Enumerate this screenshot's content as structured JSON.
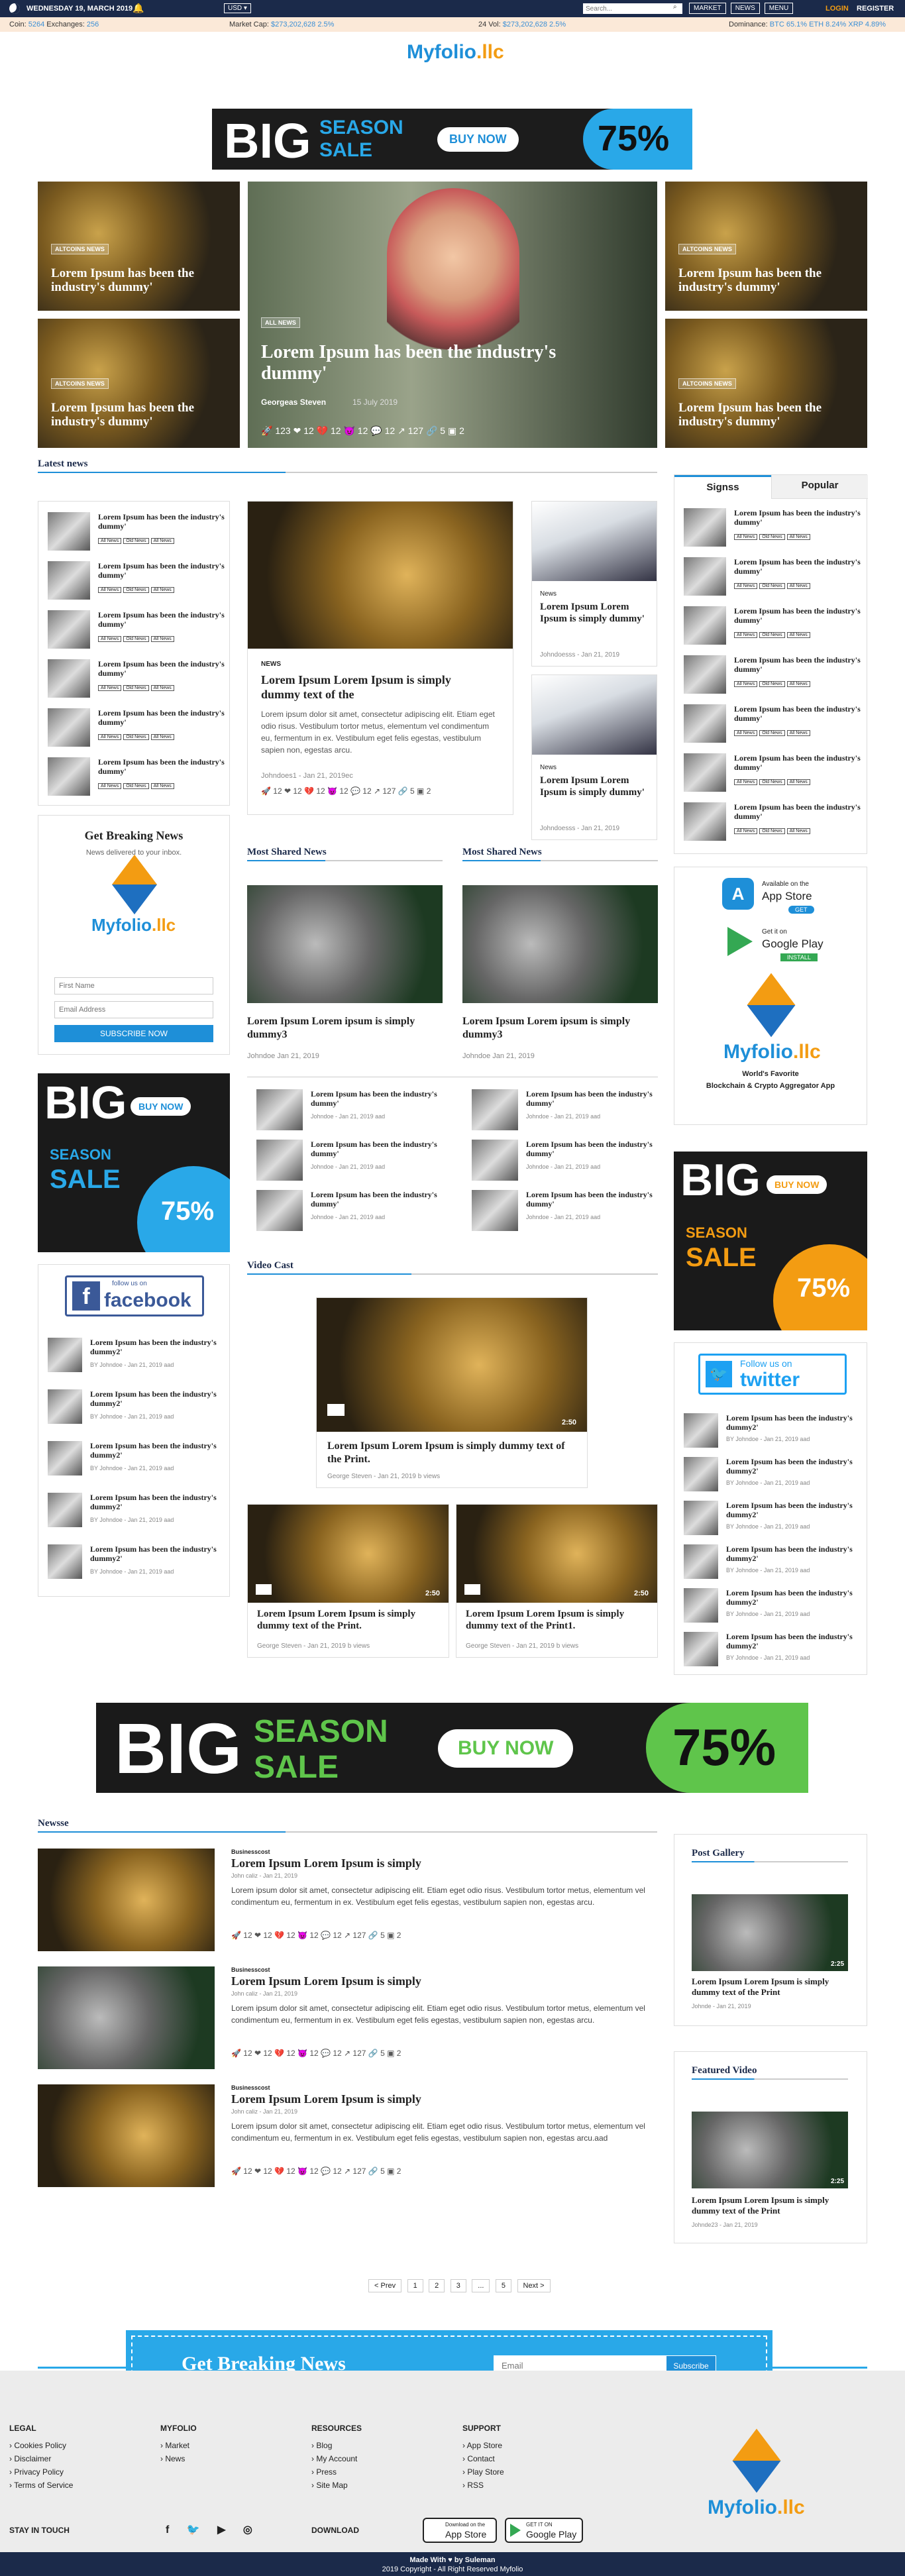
{
  "topbar": {
    "date": "WEDNESDAY 19, MARCH 2019",
    "currency": "USD",
    "search_placeholder": "Search...",
    "market": "MARKET",
    "news": "NEWS",
    "menu": "MENU",
    "login": "LOGIN",
    "register": "REGISTER"
  },
  "ticker": {
    "coins_label": "Coin:",
    "coins": "5264",
    "exchanges_label": "Exchanges:",
    "exchanges": "256",
    "mcap_label": "Market Cap:",
    "mcap": "$273,202,628 2.5%",
    "vol_label": "24 Vol:",
    "vol": "$273,202,628 2.5%",
    "dom_label": "Dominance:",
    "dom": "BTC 65.1% ETH 8.24% XRP 4.89%"
  },
  "logo": {
    "main": "Myfolio",
    "suffix": ".llc"
  },
  "banner1": {
    "big": "BIG",
    "season": "SEASON",
    "sale": "SALE",
    "buy": "BUY NOW",
    "pct": "75%"
  },
  "hero": {
    "side_tag": "ALTCOINS NEWS",
    "side_title": "Lorem Ipsum has been the industry's dummy'",
    "main_tag": "ALL NEWS",
    "main_title": "Lorem Ipsum has been the industry's dummy'",
    "author": "Georgeas Steven",
    "date": "15 July 2019",
    "stats": [
      "123",
      "12",
      "12",
      "12",
      "12",
      "127",
      "5",
      "2"
    ]
  },
  "latest": {
    "title": "Latest news",
    "item_title": "Lorem Ipsum has been the industry's dummy'",
    "pills": [
      "All News",
      "Old News",
      "All News"
    ],
    "feature_tag": "NEWS",
    "feature_title": "Lorem Ipsum Lorem Ipsum is simply dummy text of the",
    "feature_body": "Lorem ipsum dolor sit amet, consectetur adipiscing elit. Etiam eget odio risus. Vestibulum tortor metus, elementum vel condimentum eu, fermentum in ex. Vestibulum eget felis egestas, vestibulum sapien non, egestas arcu.",
    "feature_meta": "Johndoes1 - Jan 21, 2019ec",
    "right_tag": "News",
    "right_title": "Lorem Ipsum Lorem Ipsum is simply dummy'",
    "right_meta": "Johndoesss - Jan 21, 2019"
  },
  "tabs": {
    "signs": "Signss",
    "popular": "Popular"
  },
  "breaking": {
    "title": "Get Breaking News",
    "sub": "News delivered to your inbox.",
    "first": "First Name",
    "email": "Email Address",
    "btn": "SUBSCRIBE NOW"
  },
  "shared": {
    "title": "Most Shared News",
    "card_title": "Lorem Ipsum Lorem ipsum is simply dummy3",
    "card_meta": "Johndoe Jan 21, 2019",
    "item_title": "Lorem Ipsum has been the industry's dummy'",
    "item_meta": "Johndoe - Jan 21, 2019 aad"
  },
  "app": {
    "appstore_small": "Available on the",
    "appstore": "App Store",
    "get": "GET",
    "gp_small": "Get it on",
    "gp": "Google Play",
    "install": "INSTALL",
    "tag1": "World's Favorite",
    "tag2": "Blockchain & Crypto Aggregator App"
  },
  "banner2": {
    "big": "BIG",
    "buy": "BUY NOW",
    "season": "SEASON",
    "sale": "SALE",
    "pct": "75%"
  },
  "social": {
    "fb_small": "follow us on",
    "fb": "facebook",
    "tw_small": "Follow us on",
    "tw": "twitter",
    "item_title": "Lorem Ipsum has been the industry's dummy2'",
    "item_meta": "BY Johndoe - Jan 21, 2019 aad"
  },
  "video": {
    "title": "Video Cast",
    "main_title": "Lorem Ipsum Lorem Ipsum is simply dummy text of the Print.",
    "main_meta": "George Steven - Jan 21, 2019 b views",
    "dur": "2:50",
    "left_title": "Lorem Ipsum Lorem Ipsum is simply dummy text of the Print.",
    "right_title": "Lorem Ipsum Lorem Ipsum is simply dummy text of the Print1."
  },
  "banner3": {
    "big": "BIG",
    "season": "SEASON",
    "sale": "SALE",
    "buy": "BUY NOW",
    "pct": "75%"
  },
  "newsse": {
    "title": "Newsse",
    "cat": "Businesscost",
    "item_title": "Lorem Ipsum Lorem Ipsum is simply",
    "item_meta": "John caliz - Jan 21, 2019",
    "body": "Lorem ipsum dolor sit amet, consectetur adipiscing elit. Etiam eget odio risus. Vestibulum tortor metus, elementum vel condimentum eu, fermentum in ex. Vestibulum eget felis egestas, vestibulum sapien non, egestas arcu.",
    "body3": "Lorem ipsum dolor sit amet, consectetur adipiscing elit. Etiam eget odio risus. Vestibulum tortor metus, elementum vel condimentum eu, fermentum in ex. Vestibulum eget felis egestas, vestibulum sapien non, egestas arcu.aad",
    "stats": [
      "12",
      "12",
      "12",
      "12",
      "12",
      "127",
      "5",
      "2"
    ]
  },
  "gallery": {
    "title": "Post Gallery",
    "item": "Lorem Ipsum Lorem Ipsum is simply dummy text of the Print",
    "meta": "Johnde - Jan 21, 2019",
    "dur": "2:25"
  },
  "featured": {
    "title": "Featured Video",
    "item": "Lorem Ipsum Lorem Ipsum is simply dummy text of the Print",
    "meta": "Johnde23 - Jan 21, 2019",
    "dur": "2:25"
  },
  "pager": {
    "prev": "< Prev",
    "p1": "1",
    "p2": "2",
    "p3": "3",
    "dots": "...",
    "p5": "5",
    "next": "Next >"
  },
  "breakbar": {
    "title": "Get Breaking News",
    "placeholder": "Email",
    "btn": "Subscribe"
  },
  "footer": {
    "legal": "LEGAL",
    "legal_items": [
      "Cookies Policy",
      "Disclaimer",
      "Privacy Policy",
      "Terms of Service"
    ],
    "myfolio": "MYFOLIO",
    "myfolio_items": [
      "Market",
      "News"
    ],
    "resources": "RESOURCES",
    "resources_items": [
      "Blog",
      "My Account",
      "Press",
      "Site Map"
    ],
    "support": "SUPPORT",
    "support_items": [
      "App Store",
      "Contact",
      "Play Store",
      "RSS"
    ],
    "stay": "STAY IN TOUCH",
    "download": "DOWNLOAD",
    "apple_small": "Download on the",
    "apple": "App Store",
    "gp_small": "GET IT ON",
    "gp": "Google Play"
  },
  "bottom": {
    "made": "Made With ♥ by Suleman",
    "copy": "2019 Copyright - All Right Reserved Myfolio"
  },
  "colors": {
    "navy": "#1b2a4a",
    "blue": "#1e8fd8",
    "orange": "#f39c12",
    "green": "#5fc54b"
  }
}
